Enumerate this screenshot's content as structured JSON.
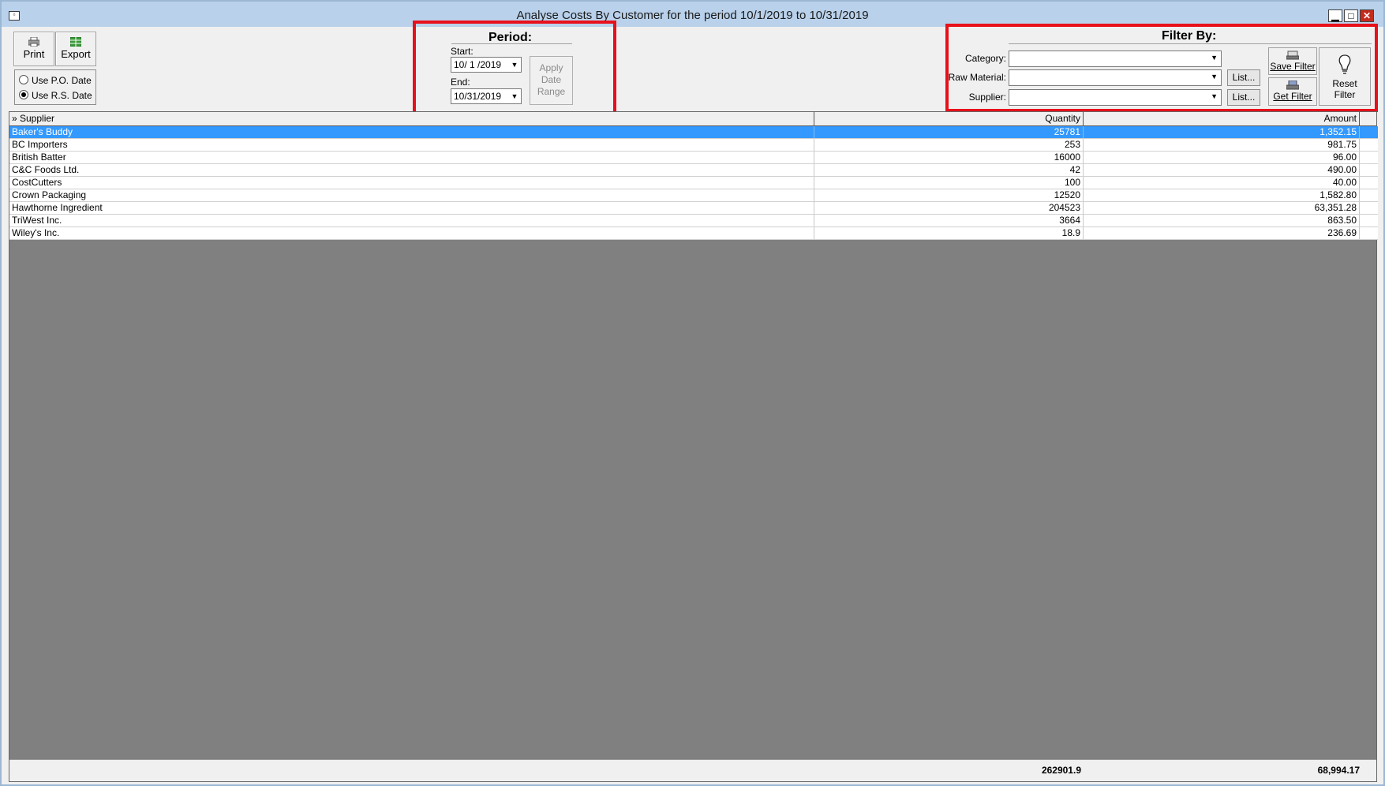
{
  "window": {
    "title": "Analyse Costs By Customer for the period 10/1/2019 to 10/31/2019",
    "icon": "app-window-icon",
    "controls": {
      "minimize": "▁",
      "maximize": "□",
      "close": "✕"
    }
  },
  "toolbar": {
    "print_label": "Print",
    "export_label": "Export",
    "date_options": [
      {
        "label": "Use P.O. Date",
        "selected": false
      },
      {
        "label": "Use R.S. Date",
        "selected": true
      }
    ]
  },
  "period": {
    "title": "Period:",
    "start_label": "Start:",
    "start_value": "10/ 1 /2019",
    "end_label": "End:",
    "end_value": "10/31/2019",
    "apply_label_1": "Apply",
    "apply_label_2": "Date",
    "apply_label_3": "Range"
  },
  "filter": {
    "title": "Filter By:",
    "category_label": "Category:",
    "category_value": "",
    "raw_material_label": "Raw Material:",
    "raw_material_value": "",
    "supplier_label": "Supplier:",
    "supplier_value": "",
    "list_label": "List...",
    "save_filter_label": "Save Filter",
    "get_filter_label": "Get Filter",
    "reset_label_1": "Reset",
    "reset_label_2": "Filter"
  },
  "grid": {
    "columns": [
      "» Supplier",
      "Quantity",
      "Amount"
    ],
    "rows": [
      {
        "supplier": "Baker's Buddy",
        "quantity": "25781",
        "amount": "1,352.15",
        "selected": true
      },
      {
        "supplier": "BC Importers",
        "quantity": "253",
        "amount": "981.75"
      },
      {
        "supplier": "British Batter",
        "quantity": "16000",
        "amount": "96.00"
      },
      {
        "supplier": "C&C Foods Ltd.",
        "quantity": "42",
        "amount": "490.00"
      },
      {
        "supplier": "CostCutters",
        "quantity": "100",
        "amount": "40.00"
      },
      {
        "supplier": "Crown Packaging",
        "quantity": "12520",
        "amount": "1,582.80"
      },
      {
        "supplier": "Hawthorne Ingredient",
        "quantity": "204523",
        "amount": "63,351.28"
      },
      {
        "supplier": "TriWest Inc.",
        "quantity": "3664",
        "amount": "863.50"
      },
      {
        "supplier": "Wiley's Inc.",
        "quantity": "18.9",
        "amount": "236.69"
      }
    ],
    "totals": {
      "quantity": "262901.9",
      "amount": "68,994.17"
    }
  },
  "colors": {
    "highlight": "#e8101a",
    "selection": "#3399ff",
    "grid_background": "#808080"
  }
}
